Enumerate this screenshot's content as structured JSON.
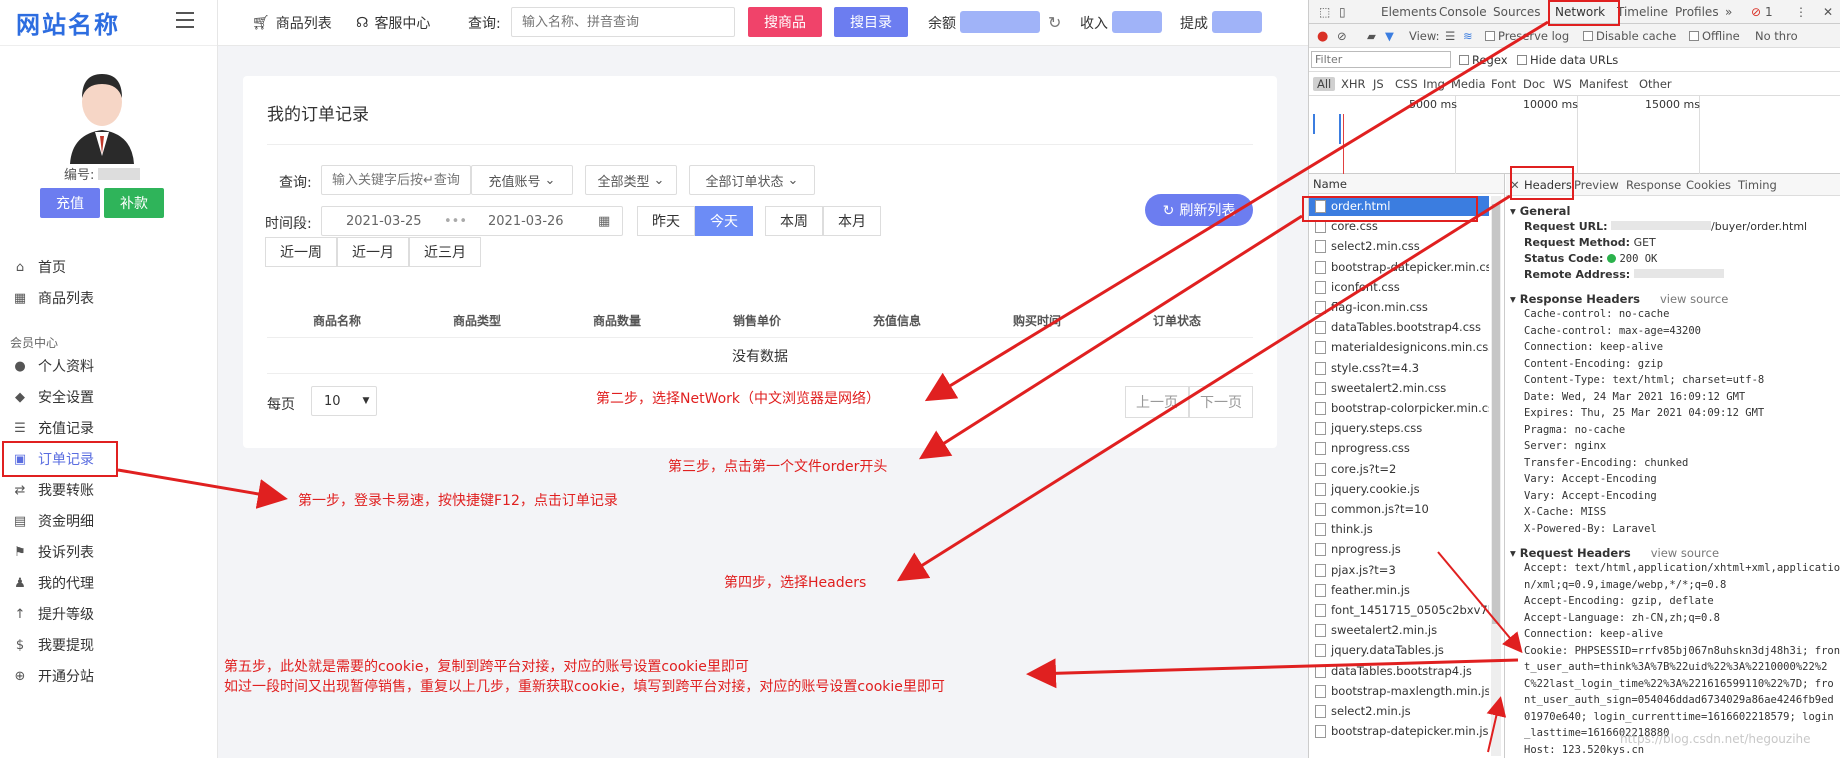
{
  "sidebar": {
    "logo": "网站名称",
    "user_id_label": "编号:",
    "recharge_button": "充值",
    "supplement_button": "补款",
    "items_top": [
      {
        "label": "首页",
        "icon": "home-icon"
      },
      {
        "label": "商品列表",
        "icon": "list-icon"
      }
    ],
    "group_title": "会员中心",
    "items": [
      {
        "label": "个人资料",
        "icon": "user-icon"
      },
      {
        "label": "安全设置",
        "icon": "shield-icon"
      },
      {
        "label": "充值记录",
        "icon": "recharge-icon"
      },
      {
        "label": "订单记录",
        "icon": "calendar-icon"
      },
      {
        "label": "我要转账",
        "icon": "transfer-icon"
      },
      {
        "label": "资金明细",
        "icon": "wallet-icon"
      },
      {
        "label": "投诉列表",
        "icon": "complaint-icon"
      },
      {
        "label": "我的代理",
        "icon": "agent-icon"
      },
      {
        "label": "提升等级",
        "icon": "arrow-up-icon"
      },
      {
        "label": "我要提现",
        "icon": "dollar-icon"
      },
      {
        "label": "开通分站",
        "icon": "plus-circle-icon"
      }
    ]
  },
  "topbar": {
    "product_list": "商品列表",
    "customer_service": "客服中心",
    "search_label": "查询:",
    "search_placeholder": "输入名称、拼音查询",
    "search_goods_button": "搜商品",
    "search_dir_button": "搜目录",
    "balance_label": "余额",
    "income_label": "收入",
    "commission_label": "提成"
  },
  "orders": {
    "title": "我的订单记录",
    "query_label": "查询:",
    "keyword_placeholder": "输入关键字后按↵查询",
    "account_select": "充值账号",
    "type_select": "全部类型",
    "status_select": "全部订单状态",
    "time_label": "时间段:",
    "date_start": "2021-03-25",
    "date_sep": "•••",
    "date_end": "2021-03-26",
    "quick": [
      "昨天",
      "今天",
      "本周",
      "本月"
    ],
    "quick2": [
      "近一周",
      "近一月",
      "近三月"
    ],
    "refresh_button": "刷新列表",
    "columns": [
      "商品名称",
      "商品类型",
      "商品数量",
      "销售单价",
      "充值信息",
      "购买时间",
      "订单状态"
    ],
    "empty": "没有数据",
    "per_page_label": "每页",
    "per_page_value": "10",
    "prev": "上一页",
    "next": "下一页"
  },
  "notes": {
    "step1": "第一步，登录卡易速，按快捷键F12，点击订单记录",
    "step2": "第二步，选择NetWork（中文浏览器是网络）",
    "step3": "第三步，点击第一个文件order开头",
    "step4": "第四步，选择Headers",
    "step5a": "第五步，此处就是需要的cookie，复制到跨平台对接，对应的账号设置cookie里即可",
    "step5b": "如过一段时间又出现暂停销售，重复以上几步，重新获取cookie，填写到跨平台对接，对应的账号设置cookie里即可"
  },
  "devtools": {
    "tabs": [
      "Elements",
      "Console",
      "Sources",
      "Network",
      "Timeline",
      "Profiles"
    ],
    "error_count": "1",
    "toolbar": {
      "view": "View:",
      "preserve_log": "Preserve log",
      "disable_cache": "Disable cache",
      "offline": "Offline",
      "no_throttle": "No thro"
    },
    "filter_placeholder": "Filter",
    "regex": "Regex",
    "hide_data_urls": "Hide data URLs",
    "types": [
      "All",
      "XHR",
      "JS",
      "CSS",
      "Img",
      "Media",
      "Font",
      "Doc",
      "WS",
      "Manifest",
      "Other"
    ],
    "timeline_labels": [
      "5000 ms",
      "10000 ms",
      "15000 ms"
    ],
    "name_header": "Name",
    "files": [
      "order.html",
      "core.css",
      "select2.min.css",
      "bootstrap-datepicker.min.css",
      "iconfont.css",
      "flag-icon.min.css",
      "dataTables.bootstrap4.css",
      "materialdesignicons.min.css",
      "style.css?t=4.3",
      "sweetalert2.min.css",
      "bootstrap-colorpicker.min.css",
      "jquery.steps.css",
      "nprogress.css",
      "core.js?t=2",
      "jquery.cookie.js",
      "common.js?t=10",
      "think.js",
      "nprogress.js",
      "pjax.js?t=3",
      "feather.min.js",
      "font_1451715_0505c2bxv7b...",
      "sweetalert2.min.js",
      "jquery.dataTables.js",
      "dataTables.bootstrap4.js",
      "bootstrap-maxlength.min.js",
      "select2.min.js",
      "bootstrap-datepicker.min.js"
    ],
    "detail_tabs": [
      "Headers",
      "Preview",
      "Response",
      "Cookies",
      "Timing"
    ],
    "general_title": "General",
    "request_url_label": "Request URL:",
    "request_url_value": "/buyer/order.html",
    "request_method_label": "Request Method:",
    "request_method_value": "GET",
    "status_code_label": "Status Code:",
    "status_code_value": "200 OK",
    "remote_address_label": "Remote Address:",
    "response_headers_title": "Response Headers",
    "view_source": "view source",
    "response_headers": [
      "Cache-control: no-cache",
      "Cache-control: max-age=43200",
      "Connection: keep-alive",
      "Content-Encoding: gzip",
      "Content-Type: text/html; charset=utf-8",
      "Date: Wed, 24 Mar 2021 16:09:12 GMT",
      "Expires: Thu, 25 Mar 2021 04:09:12 GMT",
      "Pragma: no-cache",
      "Server: nginx",
      "Transfer-Encoding: chunked",
      "Vary: Accept-Encoding",
      "Vary: Accept-Encoding",
      "X-Cache: MISS",
      "X-Powered-By: Laravel"
    ],
    "request_headers_title": "Request Headers",
    "request_headers": [
      "Accept: text/html,application/xhtml+xml,applicatio",
      "n/xml;q=0.9,image/webp,*/*;q=0.8",
      "Accept-Encoding: gzip, deflate",
      "Accept-Language: zh-CN,zh;q=0.8",
      "Connection: keep-alive",
      "Cookie: PHPSESSID=rrfv85bj067n8uhskn3dj48h3i; fron",
      "t_user_auth=think%3A%7B%22uid%22%3A%2210000%22%2",
      "C%22last_login_time%22%3A%221616599110%22%7D; fro",
      "nt_user_auth_sign=054046ddad6734029a86ae4246fb9ed",
      "01970e640; login_currenttime=1616602218579; login",
      "_lasttime=1616602218880",
      "Host: 123.520kys.cn"
    ]
  },
  "watermark": "https://blog.csdn.net/hegouzihe"
}
